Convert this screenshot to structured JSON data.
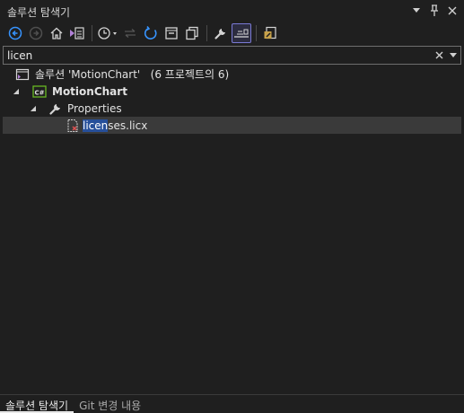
{
  "window": {
    "title": "솔루션 탐색기",
    "options_icon": "chevron-down-icon",
    "pin_icon": "pin-icon",
    "close_icon": "close-icon"
  },
  "toolbar": {
    "items": [
      {
        "name": "back-button",
        "icon": "arrow-left-circle-icon"
      },
      {
        "name": "forward-button",
        "icon": "arrow-right-circle-icon",
        "disabled": true
      },
      {
        "name": "home-button",
        "icon": "home-icon"
      },
      {
        "name": "switch-views-button",
        "icon": "switch-views-icon"
      },
      {
        "name": "pending-changes-filter-button",
        "icon": "clock-icon"
      },
      {
        "name": "sync-with-active-document-button",
        "icon": "sync-arrows-icon",
        "disabled": true
      },
      {
        "name": "refresh-button",
        "icon": "refresh-icon"
      },
      {
        "name": "collapse-all-button",
        "icon": "collapse-all-icon"
      },
      {
        "name": "show-all-files-button",
        "icon": "copy-files-icon"
      },
      {
        "name": "properties-button",
        "icon": "wrench-icon"
      },
      {
        "name": "preview-selected-items-button",
        "icon": "preview-icon",
        "active": true
      },
      {
        "name": "view-code-button",
        "icon": "edit-code-icon"
      }
    ]
  },
  "search": {
    "value": "licen",
    "clear_icon": "close-icon",
    "options_icon": "chevron-down-icon"
  },
  "tree": {
    "solution": {
      "prefix": "솔루션",
      "name": "'MotionChart'",
      "suffix": "(6 프로젝트의 6)"
    },
    "project": {
      "name": "MotionChart",
      "icon_text": "C#"
    },
    "folder": {
      "name": "Properties"
    },
    "file": {
      "match": "licen",
      "rest": "ses.licx"
    }
  },
  "bottom_tabs": [
    {
      "label": "솔루션 탐색기",
      "active": true
    },
    {
      "label": "Git 변경 내용",
      "active": false
    }
  ],
  "colors": {
    "background": "#1f1f1f",
    "accent_blue": "#3794ff",
    "selection": "#3a3a3a",
    "highlight": "#264f9a",
    "csharp_green": "#68b723",
    "solution_purple": "#b180d7"
  }
}
